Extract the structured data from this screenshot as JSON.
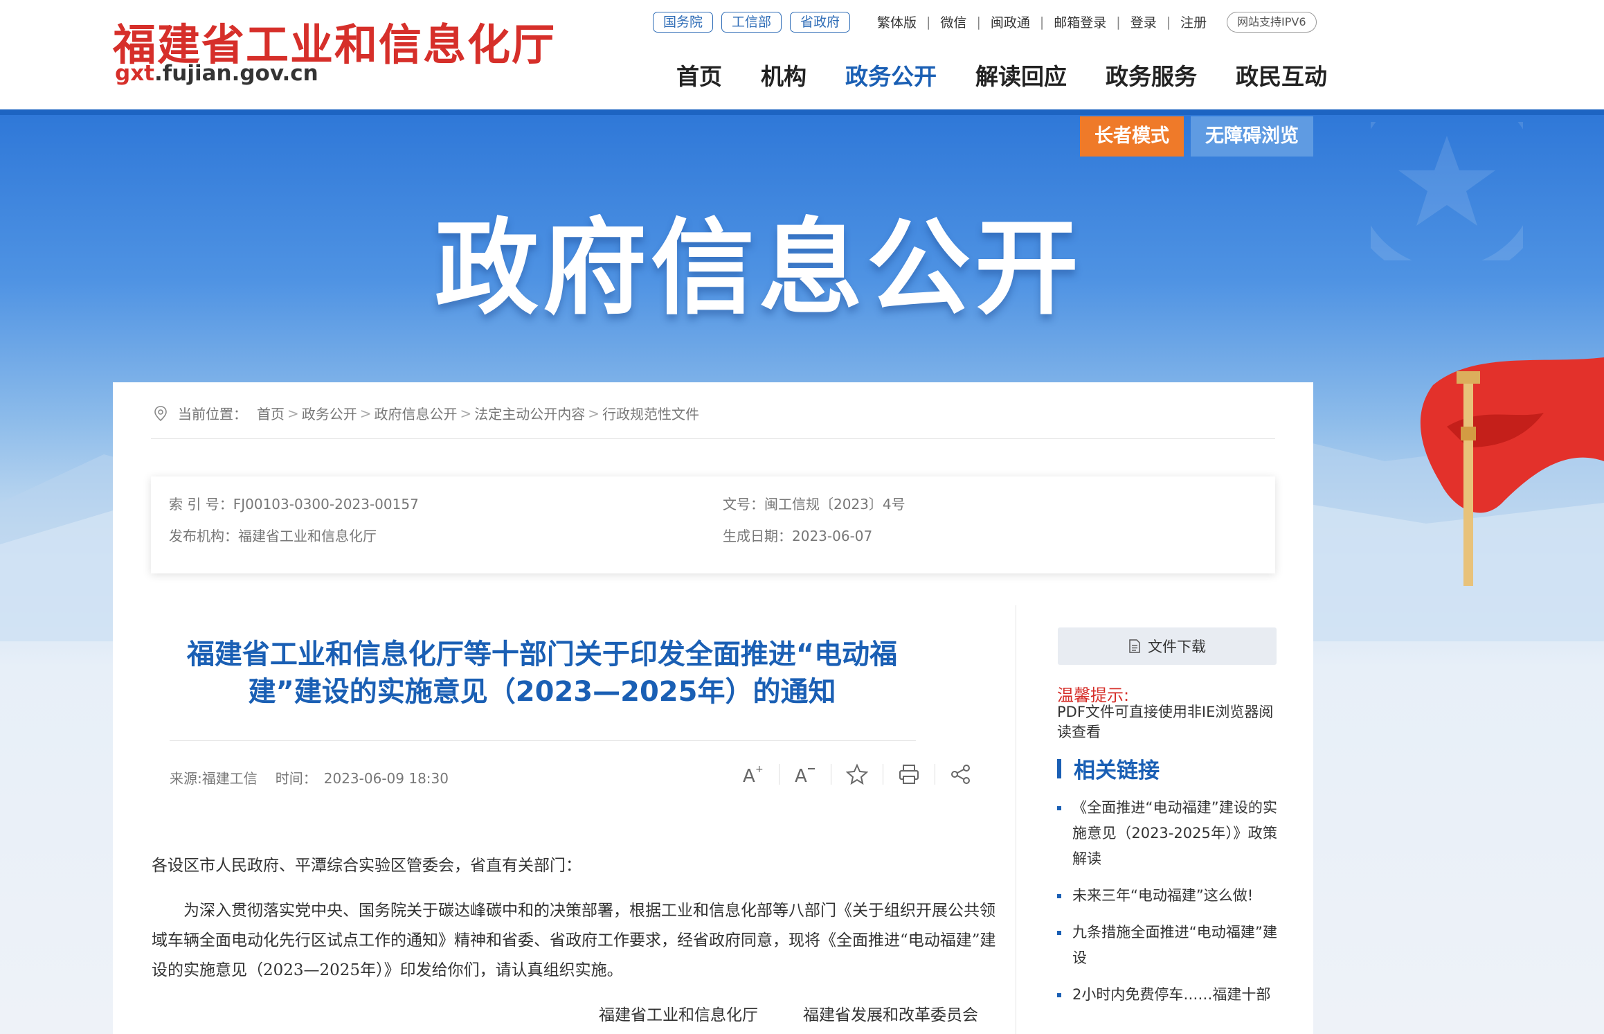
{
  "header": {
    "logo_cn": "福建省工业和信息化厅",
    "logo_url_prefix": "gxt",
    "logo_url_suffix": ".fujian.gov.cn",
    "pill_links": [
      "国务院",
      "工信部",
      "省政府"
    ],
    "util_links": [
      "繁体版",
      "微信",
      "闽政通",
      "邮箱登录",
      "登录",
      "注册"
    ],
    "ipv6_label": "网站支持IPV6",
    "nav": [
      {
        "label": "首页",
        "active": false
      },
      {
        "label": "机构",
        "active": false
      },
      {
        "label": "政务公开",
        "active": true
      },
      {
        "label": "解读回应",
        "active": false
      },
      {
        "label": "政务服务",
        "active": false
      },
      {
        "label": "政民互动",
        "active": false
      }
    ]
  },
  "banner": {
    "title": "政府信息公开",
    "elder_mode": "长者模式",
    "accessible": "无障碍浏览"
  },
  "breadcrumb": {
    "prefix": "当前位置：",
    "items": [
      "首页",
      "政务公开",
      "政府信息公开",
      "法定主动公开内容",
      "行政规范性文件"
    ]
  },
  "meta": {
    "index_no": "索 引 号：FJ00103-0300-2023-00157",
    "doc_no": "文号：闽工信规〔2023〕4号",
    "publisher": "发布机构：福建省工业和信息化厅",
    "created": "生成日期：2023-06-07"
  },
  "article": {
    "title": "福建省工业和信息化厅等十部门关于印发全面推进“电动福建”建设的实施意见（2023—2025年）的通知",
    "source": "来源:福建工信",
    "time_label": "时间：",
    "time": "2023-06-09 18:30",
    "p1": "各设区市人民政府、平潭综合实验区管委会，省直有关部门：",
    "p2": "为深入贯彻落实党中央、国务院关于碳达峰碳中和的决策部署，根据工业和信息化部等八部门《关于组织开展公共领域车辆全面电动化先行区试点工作的通知》精神和省委、省政府工作要求，经省政府同意，现将《全面推进“电动福建”建设的实施意见（2023—2025年）》印发给你们，请认真组织实施。",
    "signers": [
      "福建省工业和信息化厅",
      "福建省发展和改革委员会"
    ]
  },
  "sidebar": {
    "download": "文件下载",
    "tip_title": "温馨提示:",
    "tip_text": "PDF文件可直接使用非IE浏览器阅读查看",
    "related_title": "相关链接",
    "related": [
      "《全面推进“电动福建”建设的实施意见（2023-2025年）》政策解读",
      "未来三年“电动福建”这么做!",
      "九条措施全面推进“电动福建”建设",
      "2小时内免费停车……福建十部"
    ]
  },
  "colors": {
    "brand_red": "#d62f2a",
    "brand_blue": "#1a5fb4",
    "elder_orange": "#ef7a29"
  }
}
